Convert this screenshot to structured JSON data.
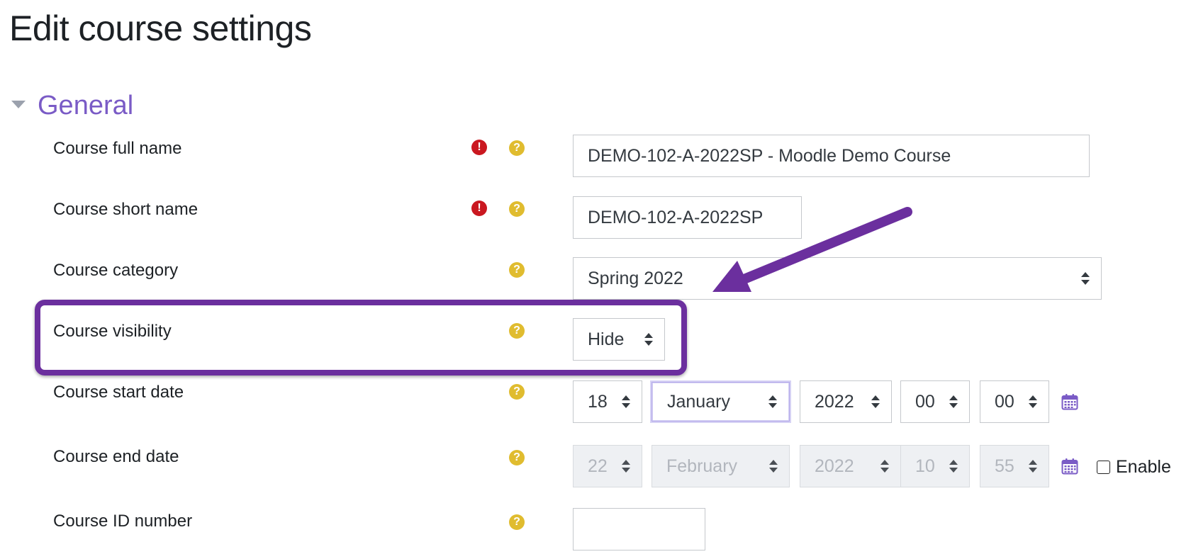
{
  "page": {
    "title": "Edit course settings"
  },
  "section": {
    "title": "General"
  },
  "icons": {
    "required": "!",
    "help": "?"
  },
  "fields": {
    "fullname": {
      "label": "Course full name",
      "value": "DEMO-102-A-2022SP - Moodle Demo Course",
      "required": true
    },
    "shortname": {
      "label": "Course short name",
      "value": "DEMO-102-A-2022SP",
      "required": true
    },
    "category": {
      "label": "Course category",
      "value": "Spring 2022"
    },
    "visibility": {
      "label": "Course visibility",
      "value": "Hide"
    },
    "startdate": {
      "label": "Course start date",
      "day": "18",
      "month": "January",
      "year": "2022",
      "hour": "00",
      "minute": "00"
    },
    "enddate": {
      "label": "Course end date",
      "day": "22",
      "month": "February",
      "year": "2022",
      "hour": "10",
      "minute": "55",
      "enable_label": "Enable",
      "enabled": false
    },
    "idnumber": {
      "label": "Course ID number",
      "value": ""
    }
  },
  "colors": {
    "accent": "#7a5bc6",
    "annotation": "#6b2f9e",
    "required": "#ca1820",
    "help": "#e0bc2f"
  }
}
